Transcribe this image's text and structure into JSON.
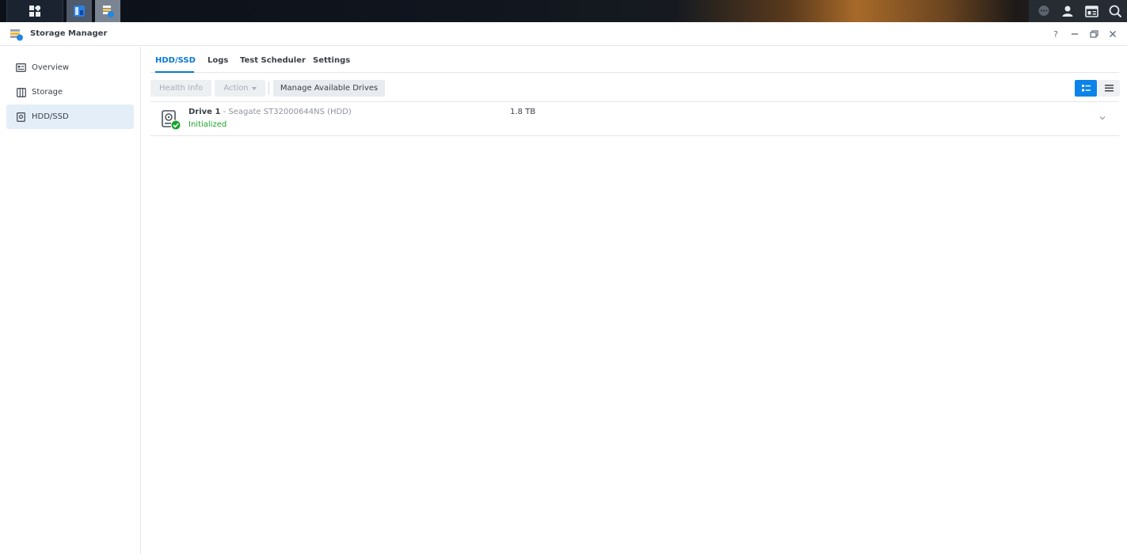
{
  "window": {
    "title": "Storage Manager"
  },
  "window_controls": {
    "help": "?",
    "minimize": "–",
    "restore": "⧉",
    "close": "✕"
  },
  "sidebar": {
    "items": [
      {
        "label": "Overview",
        "icon": "overview-icon",
        "selected": false
      },
      {
        "label": "Storage",
        "icon": "storage-icon",
        "selected": false
      },
      {
        "label": "HDD/SSD",
        "icon": "hdd-icon",
        "selected": true
      }
    ]
  },
  "tabs": [
    {
      "label": "HDD/SSD",
      "active": true
    },
    {
      "label": "Logs",
      "active": false
    },
    {
      "label": "Test Scheduler",
      "active": false
    },
    {
      "label": "Settings",
      "active": false
    }
  ],
  "toolbar": {
    "health_info": "Health Info",
    "action": "Action",
    "manage_drives": "Manage Available Drives"
  },
  "drives": [
    {
      "name": "Drive 1",
      "model": "- Seagate ST32000644NS (HDD)",
      "status": "Initialized",
      "size": "1.8 TB"
    }
  ],
  "colors": {
    "accent": "#0a78d0",
    "status_ok": "#1aa32a",
    "selected_nav": "#e4eef8"
  }
}
